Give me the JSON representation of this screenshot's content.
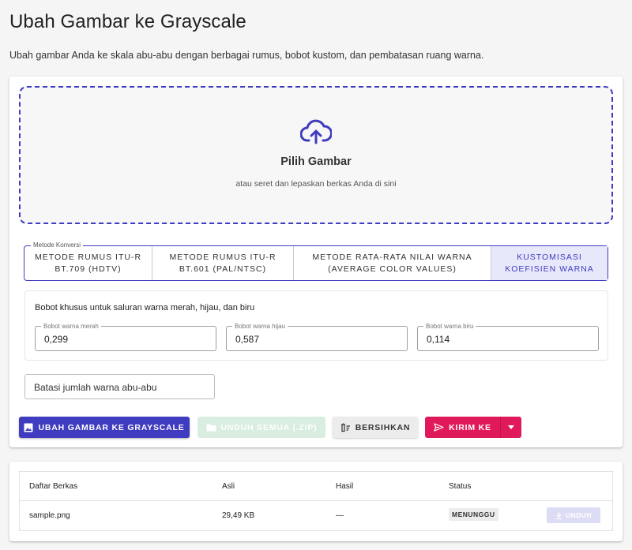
{
  "header": {
    "title": "Ubah Gambar ke Grayscale",
    "subtitle": "Ubah gambar Anda ke skala abu-abu dengan berbagai rumus, bobot kustom, dan pembatasan ruang warna."
  },
  "dropzone": {
    "icon": "cloud-upload-icon",
    "title": "Pilih Gambar",
    "hint": "atau seret dan lepaskan berkas Anda di sini"
  },
  "method": {
    "legend": "Metode Konversi",
    "options": [
      {
        "line1": "METODE RUMUS ITU-R",
        "line2": "BT.709 (HDTV)",
        "selected": false
      },
      {
        "line1": "METODE RUMUS ITU-R",
        "line2": "BT.601 (PAL/NTSC)",
        "selected": false
      },
      {
        "line1": "METODE RATA-RATA NILAI WARNA",
        "line2": "(AVERAGE COLOR VALUES)",
        "selected": false
      },
      {
        "line1": "KUSTOMISASI",
        "line2": "KOEFISIEN WARNA",
        "selected": true
      }
    ]
  },
  "weights": {
    "title": "Bobot khusus untuk saluran warna merah, hijau, dan biru",
    "red": {
      "label": "Bobot warna merah",
      "value": "0,299"
    },
    "green": {
      "label": "Bobot warna hijau",
      "value": "0,587"
    },
    "blue": {
      "label": "Bobot warna biru",
      "value": "0,114"
    }
  },
  "limit": {
    "placeholder": "Batasi jumlah warna abu-abu"
  },
  "actions": {
    "convert": "UBAH GAMBAR KE GRAYSCALE",
    "download_all": "UNDUH SEMUA (.ZIP)",
    "clear": "BERSIHKAN",
    "send": "KIRIM KE"
  },
  "files": {
    "columns": [
      "Daftar Berkas",
      "Asli",
      "Hasil",
      "Status"
    ],
    "rows": [
      {
        "name": "sample.png",
        "original": "29,49 KB",
        "result": "—",
        "status": "MENUNGGU",
        "action": "UNDUH"
      }
    ]
  },
  "colors": {
    "primary": "#3f3cbf",
    "accent": "#e0195a",
    "selected_bg": "#e8e8fb"
  }
}
